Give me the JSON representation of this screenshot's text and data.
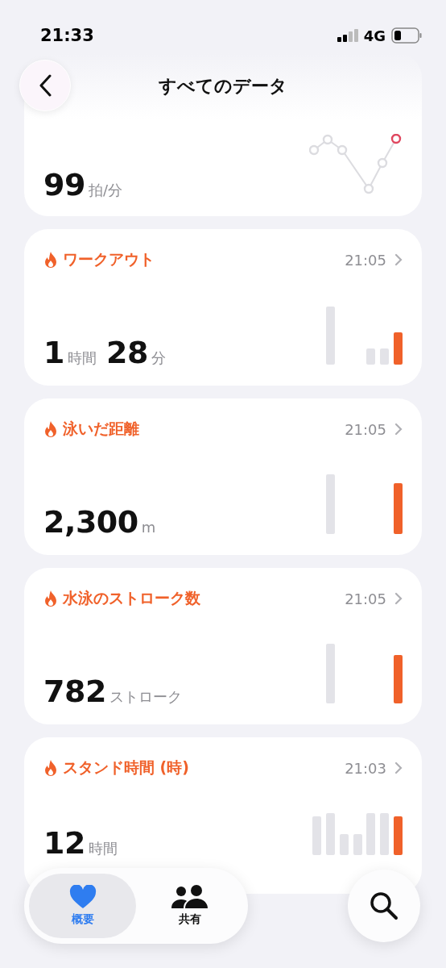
{
  "status_bar": {
    "time": "21:33",
    "network": "4G"
  },
  "header": {
    "title": "すべてのデータ"
  },
  "cards": [
    {
      "kind": "sparkline",
      "value": [
        {
          "kind": "number",
          "text": "99"
        },
        {
          "kind": "unit",
          "text": "拍/分"
        }
      ]
    },
    {
      "kind": "bars",
      "title": "ワークアウト",
      "time": "21:05",
      "value": [
        {
          "kind": "number",
          "text": "1"
        },
        {
          "kind": "unit",
          "text": "時間"
        },
        {
          "kind": "number",
          "text": "28"
        },
        {
          "kind": "unit",
          "text": "分"
        }
      ]
    },
    {
      "kind": "bars",
      "title": "泳いだ距離",
      "time": "21:05",
      "value": [
        {
          "kind": "number",
          "text": "2,300"
        },
        {
          "kind": "unit",
          "text": "m"
        }
      ]
    },
    {
      "kind": "bars",
      "title": "水泳のストローク数",
      "time": "21:05",
      "value": [
        {
          "kind": "number",
          "text": "782"
        },
        {
          "kind": "unit",
          "text": "ストローク"
        }
      ]
    },
    {
      "kind": "bars",
      "title": "スタンド時間 (時)",
      "time": "21:03",
      "value": [
        {
          "kind": "number",
          "text": "12"
        },
        {
          "kind": "unit",
          "text": "時間"
        }
      ]
    }
  ],
  "tab_bar": {
    "tabs": [
      {
        "label": "概要",
        "selected": true
      },
      {
        "label": "共有",
        "selected": false
      }
    ]
  }
}
